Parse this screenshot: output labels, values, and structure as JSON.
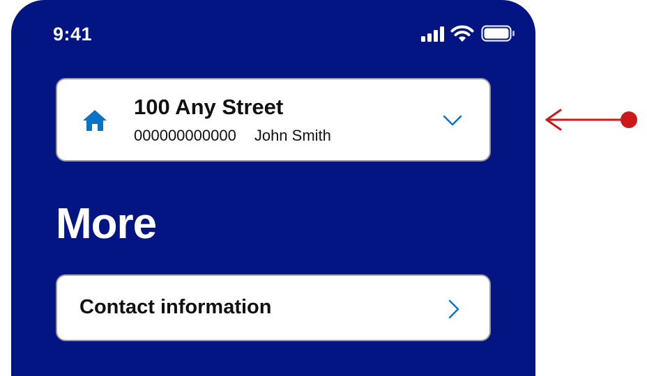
{
  "status_bar": {
    "time": "9:41"
  },
  "account": {
    "address": "100 Any Street",
    "account_number": "000000000000",
    "customer_name": "John Smith",
    "icon": "home-icon"
  },
  "page": {
    "title": "More"
  },
  "menu": {
    "items": [
      {
        "label": "Contact information"
      }
    ]
  },
  "colors": {
    "background": "#021582",
    "accent": "#0a73c4",
    "annotation": "#cc1a1a"
  }
}
